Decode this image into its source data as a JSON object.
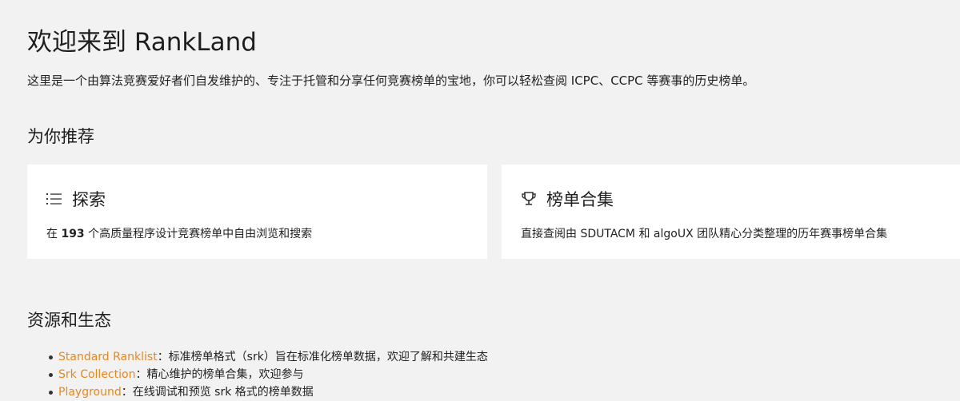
{
  "header": {
    "title": "欢迎来到 RankLand",
    "intro": "这里是一个由算法竞赛爱好者们自发维护的、专注于托管和分享任何竞赛榜单的宝地，你可以轻松查阅 ICPC、CCPC 等赛事的历史榜单。"
  },
  "recommend": {
    "title": "为你推荐",
    "cards": [
      {
        "icon": "list-icon",
        "title": "探索",
        "desc_prefix": "在 ",
        "desc_count": "193",
        "desc_suffix": " 个高质量程序设计竞赛榜单中自由浏览和搜索"
      },
      {
        "icon": "trophy-icon",
        "title": "榜单合集",
        "desc": "直接查阅由 SDUTACM 和 algoUX 团队精心分类整理的历年赛事榜单合集"
      }
    ]
  },
  "resources": {
    "title": "资源和生态",
    "items": [
      {
        "link": "Standard Ranklist",
        "text": "：标准榜单格式（srk）旨在标准化榜单数据，欢迎了解和共建生态"
      },
      {
        "link": "Srk Collection",
        "text": "：精心维护的榜单合集，欢迎参与"
      },
      {
        "link": "Playground",
        "text": "：在线调试和预览 srk 格式的榜单数据"
      }
    ]
  },
  "colors": {
    "background": "#f2f2f2",
    "card": "#ffffff",
    "link": "#e8871e"
  }
}
